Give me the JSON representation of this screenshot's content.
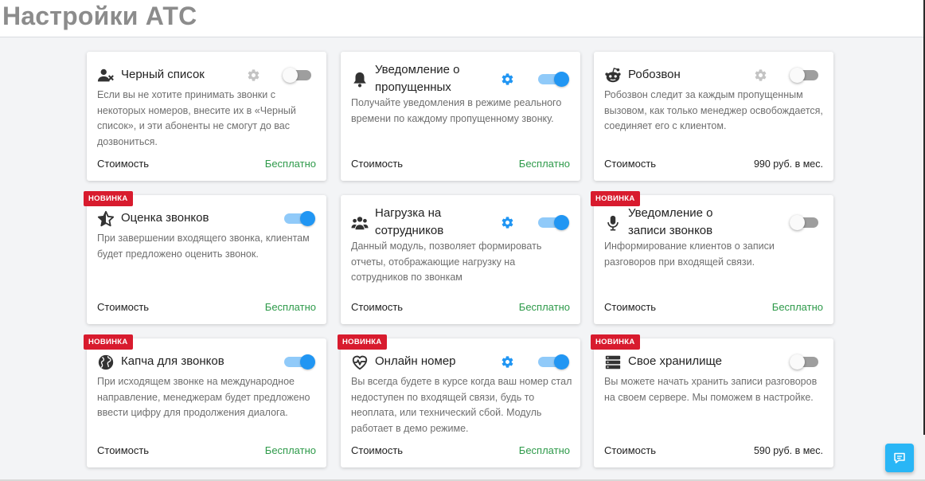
{
  "page": {
    "title": "Настройки АТС"
  },
  "colors": {
    "accent": "#2196f3",
    "free": "#2e9a4a",
    "badge": "#d81b2e",
    "chat": "#29b6f6"
  },
  "cost_label": "Стоимость",
  "badge_label": "НОВИНКА",
  "cards": [
    {
      "icon": "user-block-icon",
      "title": "Черный список",
      "has_gear": true,
      "gear_active": false,
      "enabled": false,
      "is_new": false,
      "description": "Если вы не хотите принимать звонки с некоторых номеров, внесите их в «Черный список», и эти абоненты не смогут до вас дозвониться.",
      "price": "Бесплатно",
      "free": true
    },
    {
      "icon": "bell-icon",
      "title": "Уведомление о пропущенных",
      "has_gear": true,
      "gear_active": true,
      "enabled": true,
      "is_new": false,
      "description": "Получайте уведомления в режиме реального времени по каждому пропущенному звонку.",
      "price": "Бесплатно",
      "free": true
    },
    {
      "icon": "robot-icon",
      "title": "Робозвон",
      "has_gear": true,
      "gear_active": false,
      "enabled": false,
      "is_new": false,
      "description": "Робозвон следит за каждым пропущенным вызовом, как только менеджер освобождается, соединяет его с клиентом.",
      "price": "990 руб. в мес.",
      "free": false
    },
    {
      "icon": "star-half-icon",
      "title": "Оценка звонков",
      "has_gear": false,
      "gear_active": false,
      "enabled": true,
      "is_new": true,
      "description": "При завершении входящего звонка, клиентам будет предложено оценить звонок.",
      "price": "Бесплатно",
      "free": true
    },
    {
      "icon": "users-icon",
      "title": "Нагрузка на сотрудников",
      "has_gear": true,
      "gear_active": true,
      "enabled": true,
      "is_new": false,
      "description": "Данный модуль, позволяет формировать отчеты, отображающие нагрузку на сотрудников по звонкам",
      "price": "Бесплатно",
      "free": true
    },
    {
      "icon": "microphone-icon",
      "title": "Уведомление о записи звонков",
      "has_gear": false,
      "gear_active": false,
      "enabled": false,
      "is_new": true,
      "description": "Информирование клиентов о записи разговоров при входящей связи.",
      "price": "Бесплатно",
      "free": true
    },
    {
      "icon": "globe-icon",
      "title": "Капча для звонков",
      "has_gear": false,
      "gear_active": false,
      "enabled": true,
      "is_new": true,
      "description": "При исходящем звонке на международное направление, менеджерам будет предложено ввести цифру для продолжения диалога.",
      "price": "Бесплатно",
      "free": true
    },
    {
      "icon": "heartbeat-icon",
      "title": "Онлайн номер",
      "has_gear": true,
      "gear_active": true,
      "enabled": true,
      "is_new": true,
      "description": "Вы всегда будете в курсе когда ваш номер стал недоступен по входящей связи, будь то неоплата, или технический сбой. Модуль работает в демо режиме.",
      "price": "Бесплатно",
      "free": true
    },
    {
      "icon": "server-icon",
      "title": "Свое хранилище",
      "has_gear": false,
      "gear_active": false,
      "enabled": false,
      "is_new": true,
      "description": "Вы можете начать хранить записи разговоров на своем сервере. Мы поможем в настройке.",
      "price": "590 руб. в мес.",
      "free": false
    }
  ]
}
